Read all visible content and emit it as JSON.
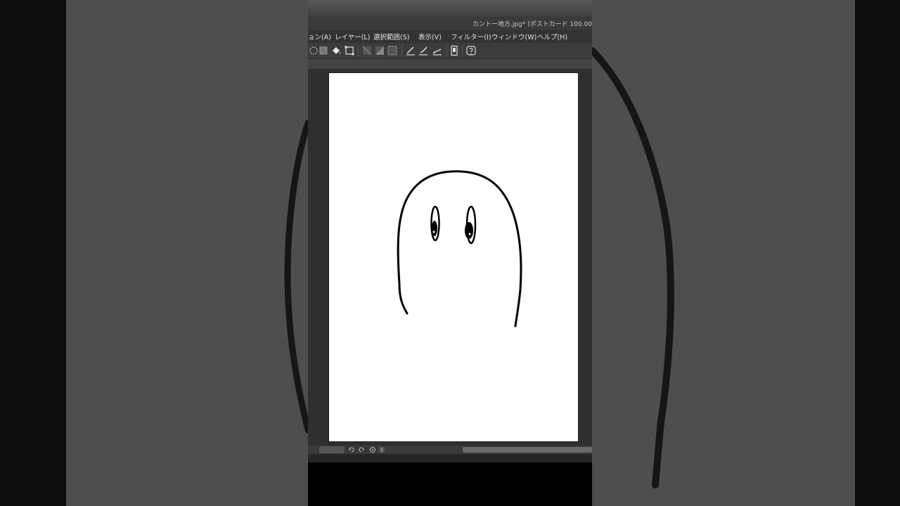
{
  "window": {
    "title": "カントー地方.jpg* (ポストカード 100.00"
  },
  "menubar": {
    "items": [
      {
        "label": "ョン(A)",
        "name": "menu-animation"
      },
      {
        "label": "レイヤー(L)",
        "name": "menu-layer"
      },
      {
        "label": "選択範囲(S)",
        "name": "menu-selection"
      },
      {
        "label": "表示(V)",
        "name": "menu-view"
      },
      {
        "label": "フィルター(I)",
        "name": "menu-filter"
      },
      {
        "label": "ウィンドウ(W)",
        "name": "menu-window"
      },
      {
        "label": "ヘルプ(H)",
        "name": "menu-help"
      }
    ]
  },
  "toolbar": {
    "icons": [
      "lasso-select-icon",
      "select-all-icon",
      "fill-icon",
      "transform-icon",
      "snap-ruler-icon",
      "snap-special-ruler-icon",
      "snap-grid-icon",
      "pen-correction-icon",
      "brush-correction-icon",
      "ruler-line-icon",
      "device-icon",
      "help-icon"
    ]
  },
  "statusbar": {
    "icons": [
      "rotate-left-icon",
      "rotate-right-icon",
      "reset-rotation-icon",
      "flip-icon"
    ]
  },
  "colors": {
    "app_bg": "#2c2c2c",
    "paper": "#ffffff",
    "ink": "#000000",
    "backdrop": "#4e4e4e"
  }
}
